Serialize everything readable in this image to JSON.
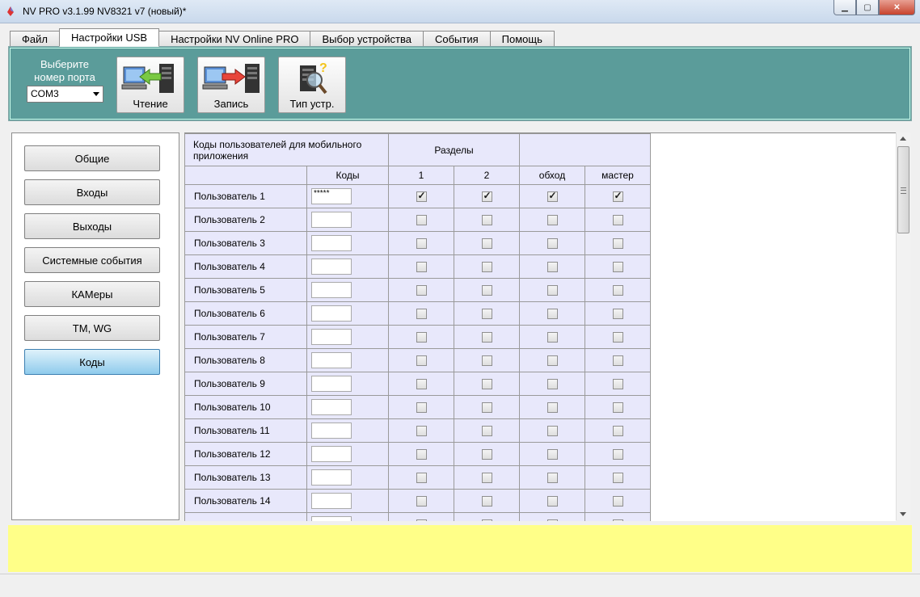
{
  "window": {
    "title": "NV PRO v3.1.99 NV8321 v7 (новый)*"
  },
  "tabs": [
    {
      "label": "Файл",
      "active": false
    },
    {
      "label": "Настройки USB",
      "active": true
    },
    {
      "label": "Настройки NV Online PRO",
      "active": false
    },
    {
      "label": "Выбор устройства",
      "active": false
    },
    {
      "label": "События",
      "active": false
    },
    {
      "label": "Помощь",
      "active": false
    }
  ],
  "toolbar": {
    "port_label_line1": "Выберите",
    "port_label_line2": "номер порта",
    "port_value": "COM3",
    "read_label": "Чтение",
    "write_label": "Запись",
    "type_label": "Тип устр."
  },
  "sidebar": {
    "items": [
      {
        "label": "Общие"
      },
      {
        "label": "Входы"
      },
      {
        "label": "Выходы"
      },
      {
        "label": "Системные события"
      },
      {
        "label": "КАМеры"
      },
      {
        "label": "TM, WG"
      },
      {
        "label": "Коды",
        "active": true
      }
    ]
  },
  "grid": {
    "header_title": "Коды пользователей для мобильного приложения",
    "header_sections": "Разделы",
    "col_codes": "Коды",
    "col_1": "1",
    "col_2": "2",
    "col_bypass": "обход",
    "col_master": "мастер",
    "rows": [
      {
        "name": "Пользователь 1",
        "code": "*****",
        "c1": true,
        "c2": true,
        "bypass": true,
        "master": true
      },
      {
        "name": "Пользователь 2",
        "code": "",
        "c1": false,
        "c2": false,
        "bypass": false,
        "master": false
      },
      {
        "name": "Пользователь 3",
        "code": "",
        "c1": false,
        "c2": false,
        "bypass": false,
        "master": false
      },
      {
        "name": "Пользователь 4",
        "code": "",
        "c1": false,
        "c2": false,
        "bypass": false,
        "master": false
      },
      {
        "name": "Пользователь 5",
        "code": "",
        "c1": false,
        "c2": false,
        "bypass": false,
        "master": false
      },
      {
        "name": "Пользователь 6",
        "code": "",
        "c1": false,
        "c2": false,
        "bypass": false,
        "master": false
      },
      {
        "name": "Пользователь 7",
        "code": "",
        "c1": false,
        "c2": false,
        "bypass": false,
        "master": false
      },
      {
        "name": "Пользователь 8",
        "code": "",
        "c1": false,
        "c2": false,
        "bypass": false,
        "master": false
      },
      {
        "name": "Пользователь 9",
        "code": "",
        "c1": false,
        "c2": false,
        "bypass": false,
        "master": false
      },
      {
        "name": "Пользователь 10",
        "code": "",
        "c1": false,
        "c2": false,
        "bypass": false,
        "master": false
      },
      {
        "name": "Пользователь 11",
        "code": "",
        "c1": false,
        "c2": false,
        "bypass": false,
        "master": false
      },
      {
        "name": "Пользователь 12",
        "code": "",
        "c1": false,
        "c2": false,
        "bypass": false,
        "master": false
      },
      {
        "name": "Пользователь 13",
        "code": "",
        "c1": false,
        "c2": false,
        "bypass": false,
        "master": false
      },
      {
        "name": "Пользователь 14",
        "code": "",
        "c1": false,
        "c2": false,
        "bypass": false,
        "master": false
      },
      {
        "name": "",
        "code": "",
        "c1": false,
        "c2": false,
        "bypass": false,
        "master": false
      }
    ]
  },
  "colors": {
    "toolbar_bg": "#5b9c9a",
    "grid_cell_bg": "#e8e8fb",
    "status_bg": "#ffff88",
    "active_nav": "#8fcbec"
  }
}
